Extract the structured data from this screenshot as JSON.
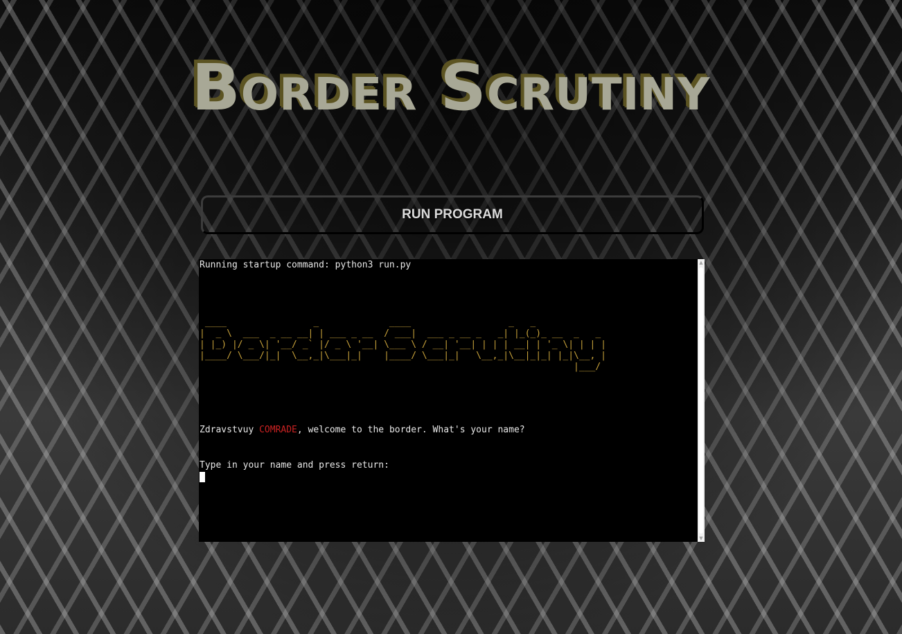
{
  "app": {
    "title": "Border Scrutiny"
  },
  "toolbar": {
    "run_label": "RUN PROGRAM"
  },
  "terminal": {
    "startup_line": "Running startup command: python3 run.py",
    "ascii_banner": " ____                _             ____                  _   _\n|  _ \\  ___  _ __ __| | ___ _ __  / ___|  ___ _ __ _   _| |_(_)_ __  _   _\n| |_) |/ _ \\| '__/ _` |/ _ \\ '__| \\___ \\ / __| '__| | | | __| | '_ \\| | | |\n|____/ \\___/|_|  \\__,_|\\___|_|    |____/ \\___|_|   \\__,_|\\__|_|_| |_|\\__, |\n                                                                     |___/",
    "greeting_prefix": "Zdravstvuy ",
    "greeting_highlight": "COMRADE",
    "greeting_suffix": ", welcome to the border. What's your name?",
    "prompt_line": "Type in your name and press return:"
  },
  "colors": {
    "title_fill": "#a8a896",
    "title_shadow": "#5c5422",
    "ascii_banner": "#c8a23a",
    "highlight": "#cc2222",
    "terminal_bg": "#000000",
    "terminal_text": "#e8e8e8"
  },
  "icons": {
    "scroll_up": "triangle-up-icon",
    "scroll_down": "triangle-down-icon"
  }
}
